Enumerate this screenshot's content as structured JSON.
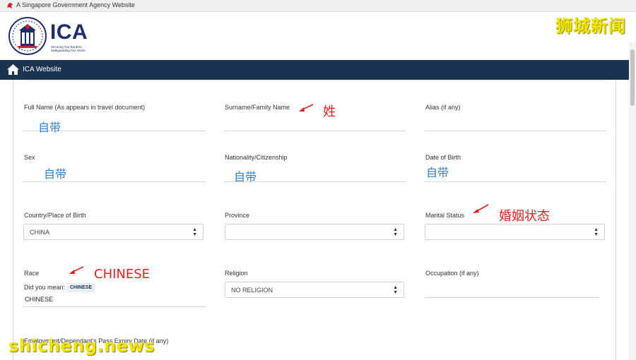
{
  "gov_bar": {
    "text": "A Singapore Government Agency Website"
  },
  "header": {
    "logo_text": "ICA",
    "logo_tagline": "Securing Our Borders, Safeguarding Our Home"
  },
  "nav": {
    "home_label": "ICA Website"
  },
  "watermarks": {
    "top": "狮城新闻",
    "bottom": "shicheng.news"
  },
  "form": {
    "full_name": {
      "label": "Full Name (As appears in travel document)",
      "value": ""
    },
    "surname": {
      "label": "Surname/Family Name",
      "value": ""
    },
    "alias": {
      "label": "Alias (if any)",
      "value": ""
    },
    "sex": {
      "label": "Sex",
      "value": ""
    },
    "nationality": {
      "label": "Nationality/Citizenship",
      "value": ""
    },
    "dob": {
      "label": "Date of Birth",
      "value": ""
    },
    "country_birth": {
      "label": "Country/Place of Birth",
      "value": "CHINA"
    },
    "province": {
      "label": "Province",
      "value": ""
    },
    "marital": {
      "label": "Marital Status",
      "value": ""
    },
    "race": {
      "label": "Race",
      "suggest_prefix": "Did you mean:",
      "suggest_value": "CHINESE",
      "value": "CHINESE"
    },
    "religion": {
      "label": "Religion",
      "value": "NO RELIGION"
    },
    "occupation": {
      "label": "Occupation (if any)",
      "value": ""
    },
    "pass_expiry": {
      "label": "Employment/Dependant's Pass Expiry Date (if any)"
    }
  },
  "annotations": {
    "full_name": "自带",
    "surname": "姓",
    "sex": "自带",
    "nationality": "自带",
    "dob": "自带",
    "marital": "婚姻状态",
    "race": "CHINESE"
  },
  "colors": {
    "nav_bg": "#1b3350",
    "annotation_blue": "#2e7fc8",
    "annotation_red": "#e02020",
    "watermark": "#f1e400",
    "logo_navy": "#1d2e6a"
  }
}
